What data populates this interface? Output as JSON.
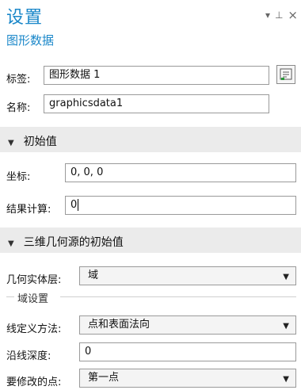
{
  "header": {
    "title": "设置",
    "subtitle": "图形数据",
    "controls": {
      "dropdown": "▾",
      "pin": "⊥",
      "close": "×"
    }
  },
  "fields": {
    "tag_label": "标签:",
    "tag_value": "图形数据 1",
    "name_label": "名称:",
    "name_value": "graphicsdata1"
  },
  "initial_values": {
    "section_label": "初始值",
    "coord_label": "坐标:",
    "coord_value": "0, 0, 0",
    "result_label": "结果计算:",
    "result_value": "0"
  },
  "geometry_initial": {
    "section_label": "三维几何源的初始值",
    "entity_level_label": "几何实体层:",
    "entity_level_value": "域",
    "domain_settings_label": "域设置",
    "line_method_label": "线定义方法:",
    "line_method_value": "点和表面法向",
    "depth_label": "沿线深度:",
    "depth_value": "0",
    "point_label": "要修改的点:",
    "point_value": "第一点"
  }
}
